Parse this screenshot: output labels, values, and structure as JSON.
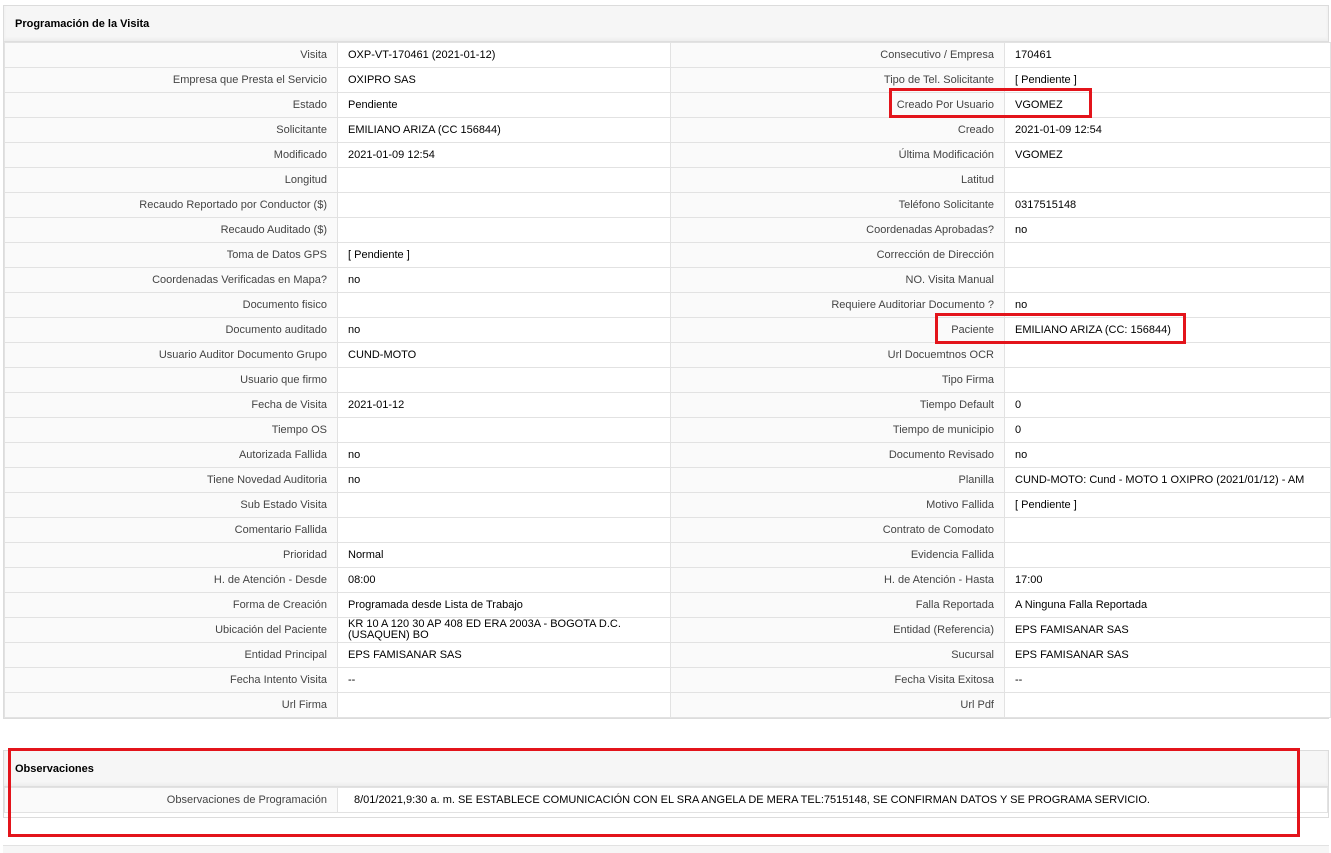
{
  "section_title": "Programación de la Visita",
  "rows": [
    {
      "l1": "Visita",
      "v1": "OXP-VT-170461 (2021-01-12)",
      "l2": "Consecutivo / Empresa",
      "v2": "170461"
    },
    {
      "l1": "Empresa que Presta el Servicio",
      "v1": "OXIPRO SAS",
      "l2": "Tipo de Tel. Solicitante",
      "v2": "[ Pendiente ]"
    },
    {
      "l1": "Estado",
      "v1": "Pendiente",
      "l2": "Creado Por Usuario",
      "v2": "VGOMEZ"
    },
    {
      "l1": "Solicitante",
      "v1": "EMILIANO ARIZA (CC 156844)",
      "l2": "Creado",
      "v2": "2021-01-09 12:54"
    },
    {
      "l1": "Modificado",
      "v1": "2021-01-09 12:54",
      "l2": "Última Modificación",
      "v2": " VGOMEZ"
    },
    {
      "l1": "Longitud",
      "v1": "",
      "l2": "Latitud",
      "v2": ""
    },
    {
      "l1": "Recaudo Reportado por Conductor ($)",
      "v1": "",
      "l2": "Teléfono Solicitante",
      "v2": "0317515148"
    },
    {
      "l1": "Recaudo Auditado ($)",
      "v1": "",
      "l2": "Coordenadas Aprobadas?",
      "v2": " no"
    },
    {
      "l1": "Toma de Datos GPS",
      "v1": "[ Pendiente ]",
      "l2": "Corrección de Dirección",
      "v2": ""
    },
    {
      "l1": "Coordenadas Verificadas en Mapa?",
      "v1": " no",
      "l2": "NO. Visita Manual",
      "v2": ""
    },
    {
      "l1": "Documento fisico",
      "v1": "",
      "l2": "Requiere Auditoriar Documento ?",
      "v2": " no"
    },
    {
      "l1": "Documento auditado",
      "v1": " no",
      "l2": "Paciente",
      "v2": "EMILIANO ARIZA (CC: 156844)"
    },
    {
      "l1": "Usuario Auditor Documento Grupo",
      "v1": "CUND-MOTO",
      "l2": "Url Docuemtnos OCR",
      "v2": ""
    },
    {
      "l1": "Usuario que firmo",
      "v1": "",
      "l2": "Tipo Firma",
      "v2": ""
    },
    {
      "l1": "Fecha de Visita",
      "v1": " 2021-01-12",
      "l2": "Tiempo Default",
      "v2": "0"
    },
    {
      "l1": "Tiempo OS",
      "v1": "",
      "l2": "Tiempo de municipio",
      "v2": "0"
    },
    {
      "l1": "Autorizada Fallida",
      "v1": " no",
      "l2": "Documento Revisado",
      "v2": " no"
    },
    {
      "l1": "Tiene Novedad Auditoria",
      "v1": " no",
      "l2": "Planilla",
      "v2": "CUND-MOTO: Cund - MOTO 1 OXIPRO (2021/01/12) - AM"
    },
    {
      "l1": "Sub Estado Visita",
      "v1": "",
      "l2": "Motivo Fallida",
      "v2": "[ Pendiente ]"
    },
    {
      "l1": "Comentario Fallida",
      "v1": "",
      "l2": "Contrato de Comodato",
      "v2": ""
    },
    {
      "l1": "Prioridad",
      "v1": "Normal",
      "l2": "Evidencia Fallida",
      "v2": ""
    },
    {
      "l1": "H. de Atención - Desde",
      "v1": "08:00",
      "l2": "H. de Atención - Hasta",
      "v2": "17:00"
    },
    {
      "l1": "Forma de Creación",
      "v1": "Programada desde Lista de Trabajo",
      "l2": "Falla Reportada",
      "v2": "A Ninguna Falla Reportada"
    },
    {
      "l1": "Ubicación del Paciente",
      "v1": "KR 10 A 120 30 AP 408 ED ERA 2003A - BOGOTA D.C. (USAQUEN) BO",
      "l2": "Entidad (Referencia)",
      "v2": "EPS FAMISANAR SAS"
    },
    {
      "l1": "Entidad Principal",
      "v1": "EPS FAMISANAR SAS",
      "l2": "Sucursal",
      "v2": "EPS FAMISANAR SAS"
    },
    {
      "l1": "Fecha Intento Visita",
      "v1": " --",
      "l2": "Fecha Visita Exitosa",
      "v2": " --"
    },
    {
      "l1": "Url Firma",
      "v1": "",
      "l2": "Url Pdf",
      "v2": ""
    }
  ],
  "observaciones": {
    "title": "Observaciones",
    "label": "Observaciones de Programación",
    "value": "8/01/2021,9:30 a. m. SE ESTABLECE COMUNICACIÓN CON EL SRA ANGELA DE MERA TEL:7515148, SE CONFIRMAN DATOS Y SE PROGRAMA SERVICIO."
  },
  "highlight_color": "#e3141b"
}
